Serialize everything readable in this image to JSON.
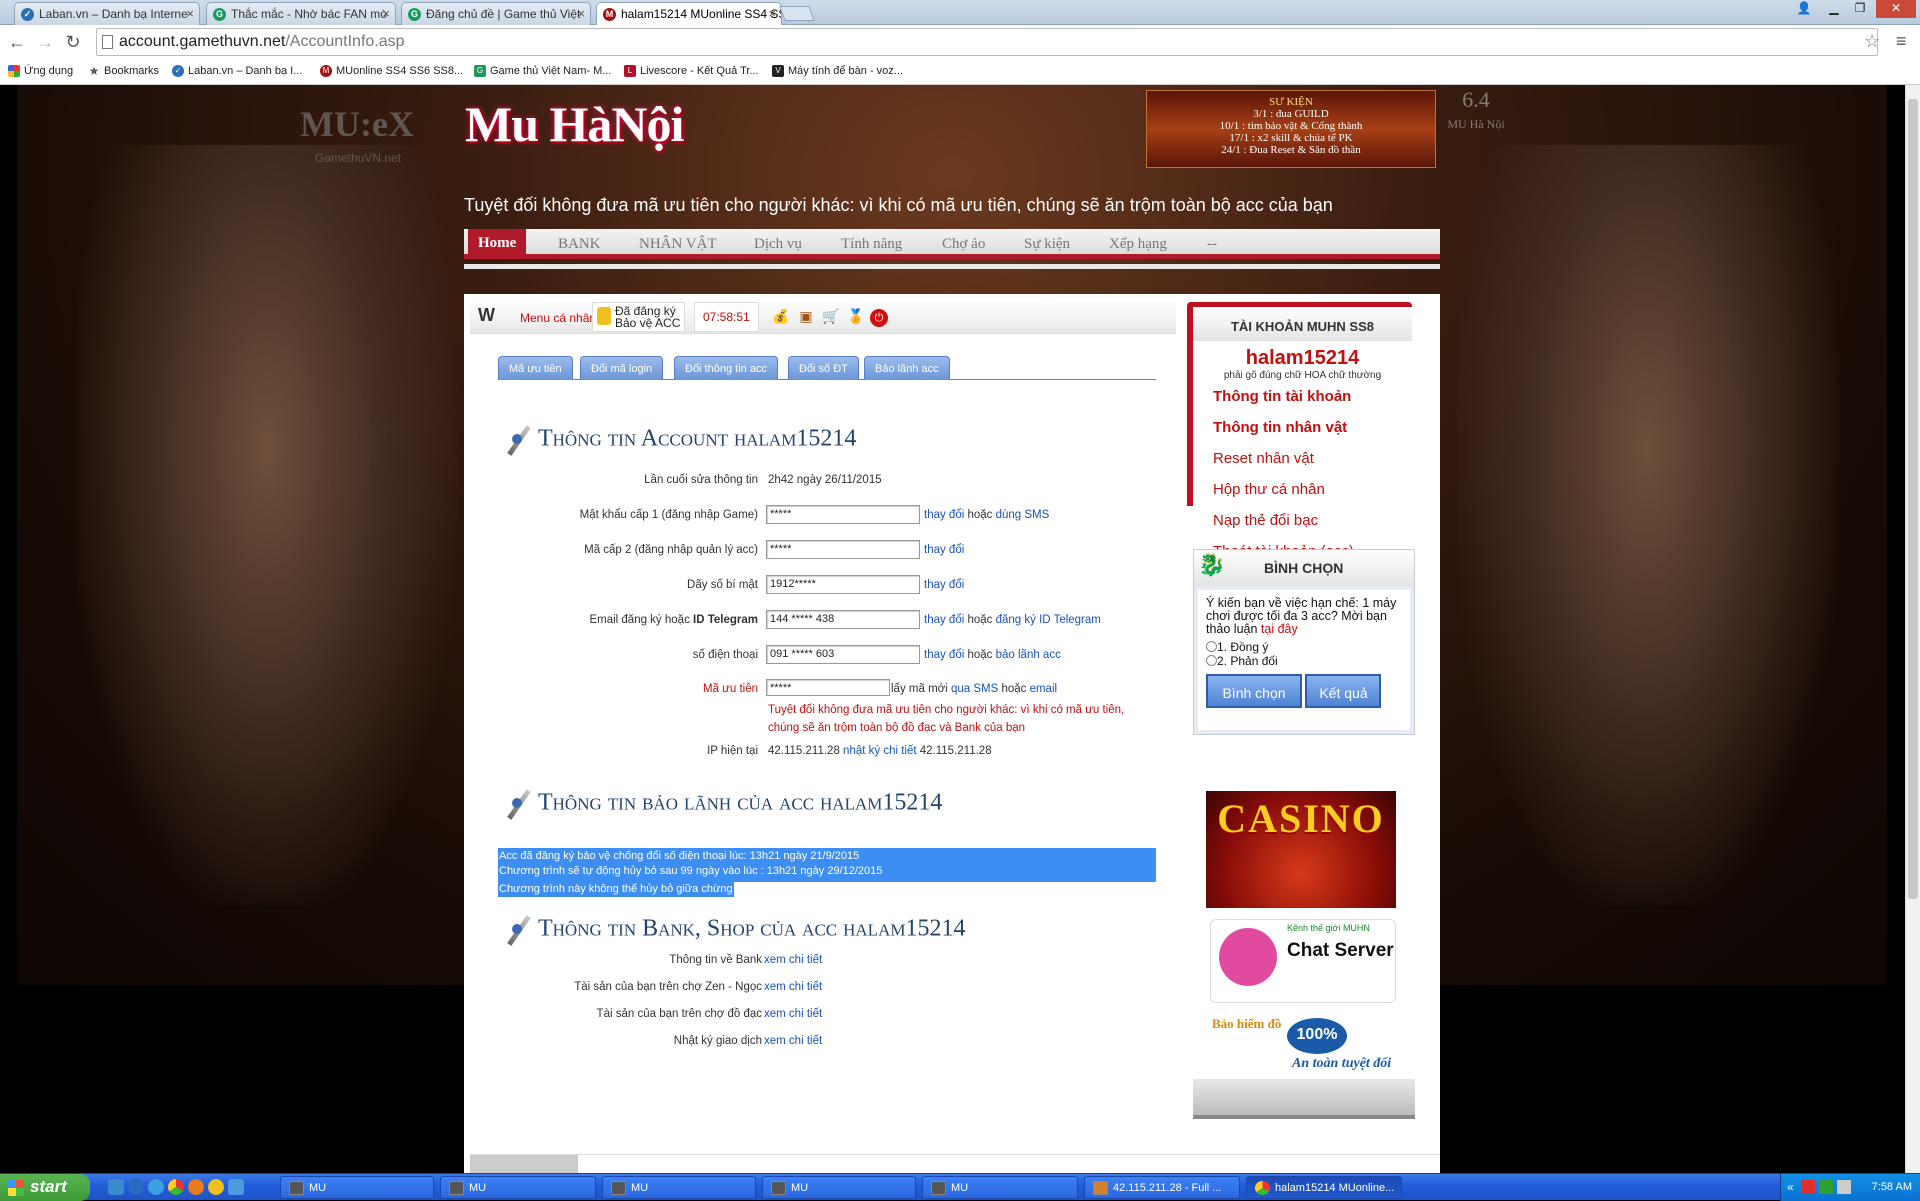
{
  "browser": {
    "tabs": [
      {
        "title": "Laban.vn – Danh bạ Interne",
        "icon": "laban-icon"
      },
      {
        "title": "Thắc mắc - Nhờ bác FAN mò",
        "icon": "g-icon"
      },
      {
        "title": "Đăng chủ đề | Game thủ Việt",
        "icon": "g-icon"
      },
      {
        "title": "halam15214 MUonline SS4 SS",
        "icon": "mu-icon"
      }
    ],
    "url_host": "account.gamethuvn.net",
    "url_path": "/AccountInfo.asp",
    "bookmarks": [
      {
        "label": "Ứng dụng",
        "icon": "apps-icon"
      },
      {
        "label": "Bookmarks",
        "icon": "star-icon"
      },
      {
        "label": "Laban.vn – Danh bạ I...",
        "icon": "laban-icon"
      },
      {
        "label": "MUonline SS4 SS6 SS8...",
        "icon": "mu-icon"
      },
      {
        "label": "Game thủ Việt Nam- M...",
        "icon": "g-icon"
      },
      {
        "label": "Livescore - Kết Quả Tr...",
        "icon": "livescore-icon"
      },
      {
        "label": "Máy tính để bàn - voz...",
        "icon": "voz-icon"
      }
    ]
  },
  "site": {
    "logo_left": "MU:eX",
    "logo_left_sub": "GamethuVN.net",
    "logo_main": "Mu HàNội",
    "banner_lines": [
      "SƯ KIỆN",
      "3/1 : đua GUILD",
      "10/1 : tìm bảo vật & Cống thành",
      "17/1 : x2 skill & chúa tể PK",
      "24/1 : Đua Reset & Săn đồ thần"
    ],
    "badge_version": "6.4",
    "badge_text": "MU Hà Nội",
    "warning": "Tuyệt đối không đưa mã ưu tiên cho người khác: vì khi có mã ưu tiên, chúng sẽ ăn trộm toàn bộ acc của bạn",
    "nav": [
      "Home",
      "BANK",
      "NHÂN VẬT",
      "Dịch vụ",
      "Tính năng",
      "Chợ ảo",
      "Sự kiện",
      "Xếp hạng",
      "--"
    ]
  },
  "topbar": {
    "menu_label": "Menu cá nhân",
    "registered_line1": "Đã đăng ký",
    "registered_line2": "Bảo vệ ACC",
    "timer": "07:58:51"
  },
  "subtabs": [
    "Mã ưu tiên",
    "Đổi mã login",
    "Đổi thông tin acc",
    "Đổi số ĐT",
    "Bảo lãnh acc"
  ],
  "account": {
    "heading": "Thông tin Account halam15214",
    "last_edit_label": "Lần cuối sửa thông tin",
    "last_edit_value": "2h42 ngày 26/11/2015",
    "pw1_label": "Mật khẩu cấp 1 (đăng nhập Game)",
    "pw1_value": "*****",
    "pw2_label": "Mã cấp 2 (đăng nhập quản lý acc)",
    "pw2_value": "*****",
    "secret_label": "Dãy số bí mật",
    "secret_value": "1912*****",
    "email_label_a": "Email đăng ký hoặc ",
    "email_label_b": "ID Telegram",
    "email_value": "144 ***** 438",
    "phone_label": "số điện thoại",
    "phone_value": "091 ***** 603",
    "priority_label": "Mã ưu tiên",
    "priority_value": "*****",
    "priority_get": "lấy mã mới ",
    "priority_sms": "qua SMS",
    "priority_or": " hoặc ",
    "priority_email": "email",
    "priority_warning": "Tuyệt đối không đưa mã ưu tiên cho người khác: vì khi có mã ưu tiên, chúng sẽ ăn trộm toàn bộ đồ đạc và Bank của bạn",
    "ip_label": "IP hiện tại",
    "ip_value": "42.115.211.28",
    "ip_log_link": "nhật ký chi tiết",
    "ip_value2": " 42.115.211.28",
    "change": "thay đổi",
    "or": " hoặc ",
    "use_sms": "dùng SMS",
    "reg_telegram": "đăng ký ID Telegram",
    "guarantee_acc": "bảo lãnh acc"
  },
  "guarantee": {
    "heading": "Thông tin bảo lãnh của acc halam15214",
    "lines": [
      "Acc đã đăng ký bảo vệ chống đổi số điện thoại lúc: 13h21 ngày 21/9/2015",
      "Chương trình sẽ tự động hủy bỏ sau 99 ngày vào lúc : 13h21 ngày 29/12/2015",
      "Chương trình này không thể hủy bỏ giữa chừng"
    ]
  },
  "bank": {
    "heading": "Thông tin Bank, Shop của acc halam15214",
    "rows": [
      {
        "label": "Thông tin về Bank",
        "link": "xem chi tiết"
      },
      {
        "label": "Tài sản của bạn trên chợ Zen - Ngọc",
        "link": "xem chi tiết"
      },
      {
        "label": "Tài sản của bạn trên chợ đồ đạc",
        "link": "xem chi tiết"
      },
      {
        "label": "Nhật ký giao dịch",
        "link": "xem chi tiết"
      }
    ]
  },
  "sidebar": {
    "title": "TÀI KHOẢN MUHN SS8",
    "username": "halam15214",
    "hint": "phải gõ đúng chữ HOA chữ thường",
    "links": [
      "Thông tin tài khoản",
      "Thông tin nhân vật",
      "Reset nhân vật",
      "Hộp thư cá nhân",
      "Nạp thẻ đổi bạc",
      "Thoát tài khoản (acc)"
    ],
    "vote_title": "BÌNH CHỌN",
    "vote_question": "Ý kiến bạn về việc hạn chế: 1 máy chơi được tối đa 3 acc? Mời bạn thảo luận ",
    "vote_here": "tại đây",
    "vote_opt1": "1. Đồng ý",
    "vote_opt2": "2. Phản đối",
    "vote_btn": "Bình chọn",
    "result_btn": "Kết quả",
    "casino": "CASINO",
    "chat_small": "Kênh thế giới MUHN",
    "chat_big": "Chat Server",
    "insure_a": "Bảo hiểm đồ",
    "insure_b": "100%",
    "insure_c": "An toàn tuyệt đối"
  },
  "taskbar": {
    "start": "start",
    "tasks": [
      "MU",
      "MU",
      "MU",
      "MU",
      "MU",
      "42.115.211.28 - Full ...",
      "halam15214 MUonline..."
    ],
    "clock": "7:58 AM"
  },
  "colors": {
    "accent_red": "#b01a2a",
    "link_blue": "#1a52b8",
    "heading_blue": "#24446e",
    "selection_blue": "#3c8ef2"
  }
}
